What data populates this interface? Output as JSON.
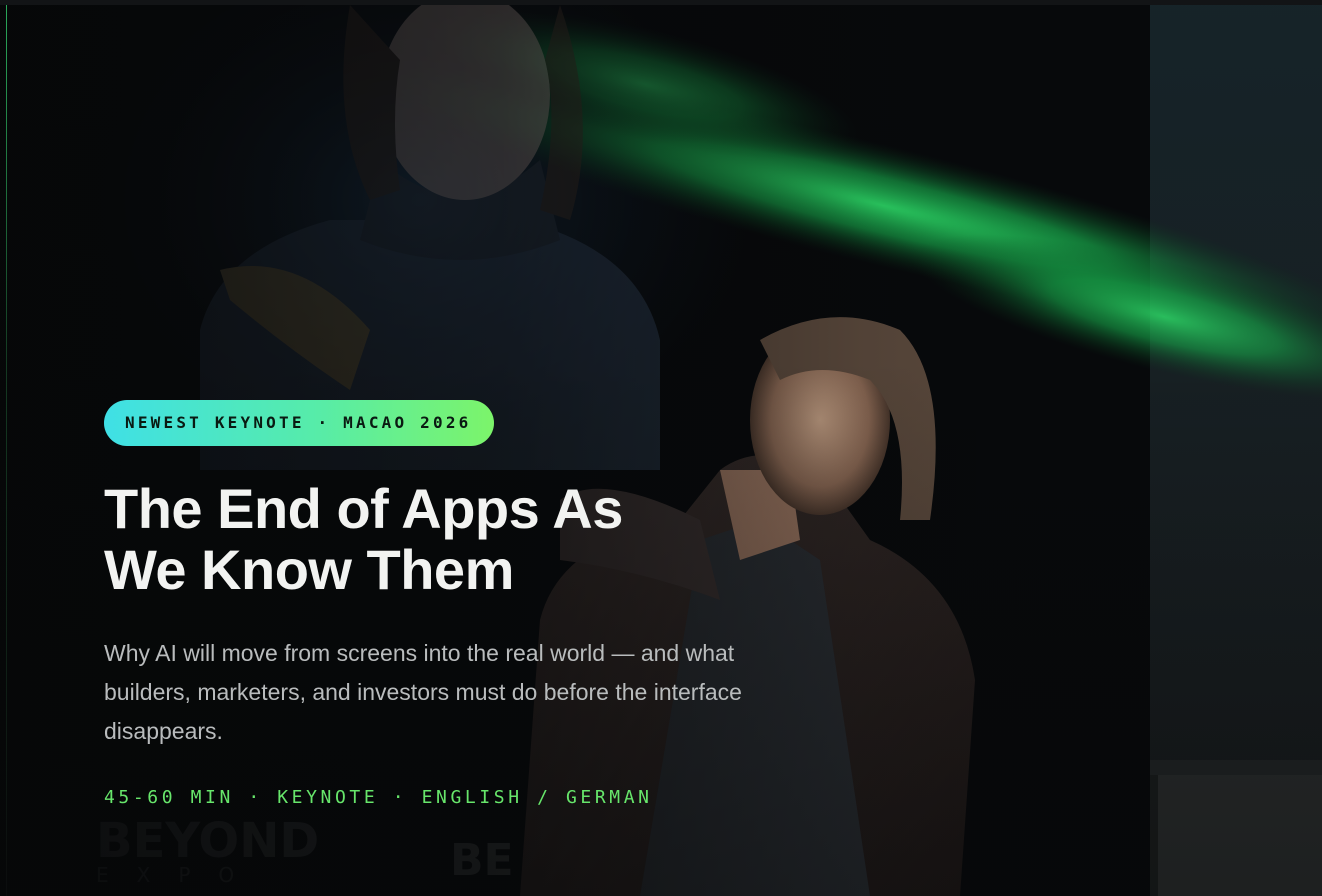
{
  "hero": {
    "badge": "NEWEST KEYNOTE · MACAO 2026",
    "title": "The End of Apps As We Know Them",
    "description": "Why AI will move from screens into the real world — and what builders, marketers, and investors must do before the interface disappears.",
    "meta": "45-60 MIN · KEYNOTE · ENGLISH / GERMAN",
    "accent_color": "#67e66b",
    "badge_gradient": [
      "#3fe0e6",
      "#7cf46a"
    ]
  }
}
